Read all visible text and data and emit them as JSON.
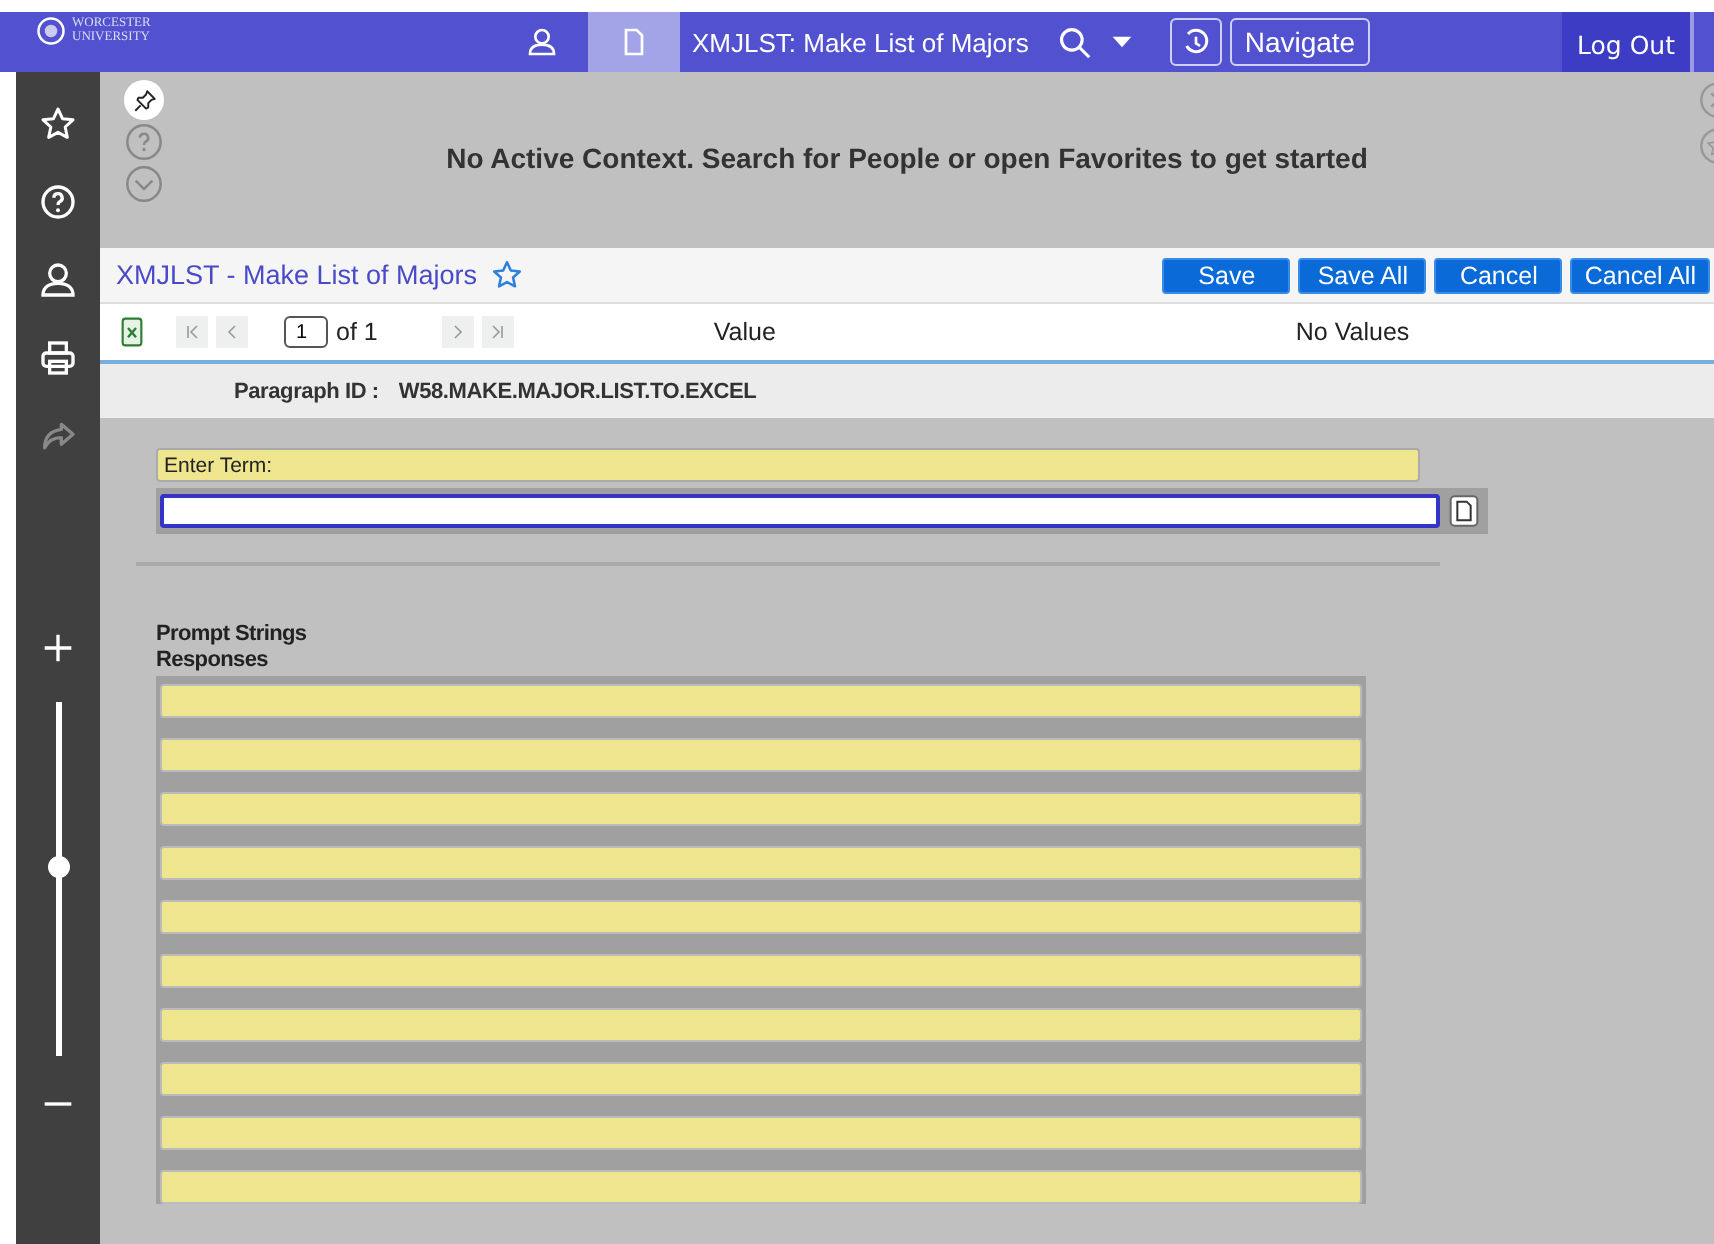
{
  "header": {
    "logo": [
      "WORCESTER",
      "UNIVERSITY"
    ],
    "tabs": [
      {
        "kind": "person",
        "selected": false
      },
      {
        "kind": "document",
        "selected": true
      }
    ],
    "title": "XMJLST: Make List of Majors",
    "navigate": "Navigate",
    "logout": "Log Out"
  },
  "sidebar": {
    "zoom": {
      "level": 0.53
    }
  },
  "context": {
    "message": "No Active Context. Search for People or open Favorites to get started"
  },
  "form": {
    "title": "XMJLST - Make List of Majors",
    "favorite": false,
    "actions": [
      "Save",
      "Save All",
      "Cancel",
      "Cancel All"
    ],
    "pager": {
      "page": "1",
      "of": "of 1",
      "first_disabled": true,
      "last_disabled": true
    },
    "value_label": "Value",
    "value": "No Values",
    "paragraph_label": "Paragraph ID :",
    "paragraph_id": "W58.MAKE.MAJOR.LIST.TO.EXCEL",
    "prompt": {
      "label": "Enter Term:"
    },
    "prompt_strings": "Prompt Strings",
    "responses_label": "Responses",
    "responses": [
      {
        "kind": "field"
      },
      {
        "kind": "field"
      },
      {
        "kind": "field"
      },
      {
        "kind": "field"
      },
      {
        "kind": "field"
      },
      {
        "kind": "field"
      },
      {
        "kind": "field"
      },
      {
        "kind": "field"
      },
      {
        "kind": "field"
      },
      {
        "kind": "field"
      }
    ]
  }
}
